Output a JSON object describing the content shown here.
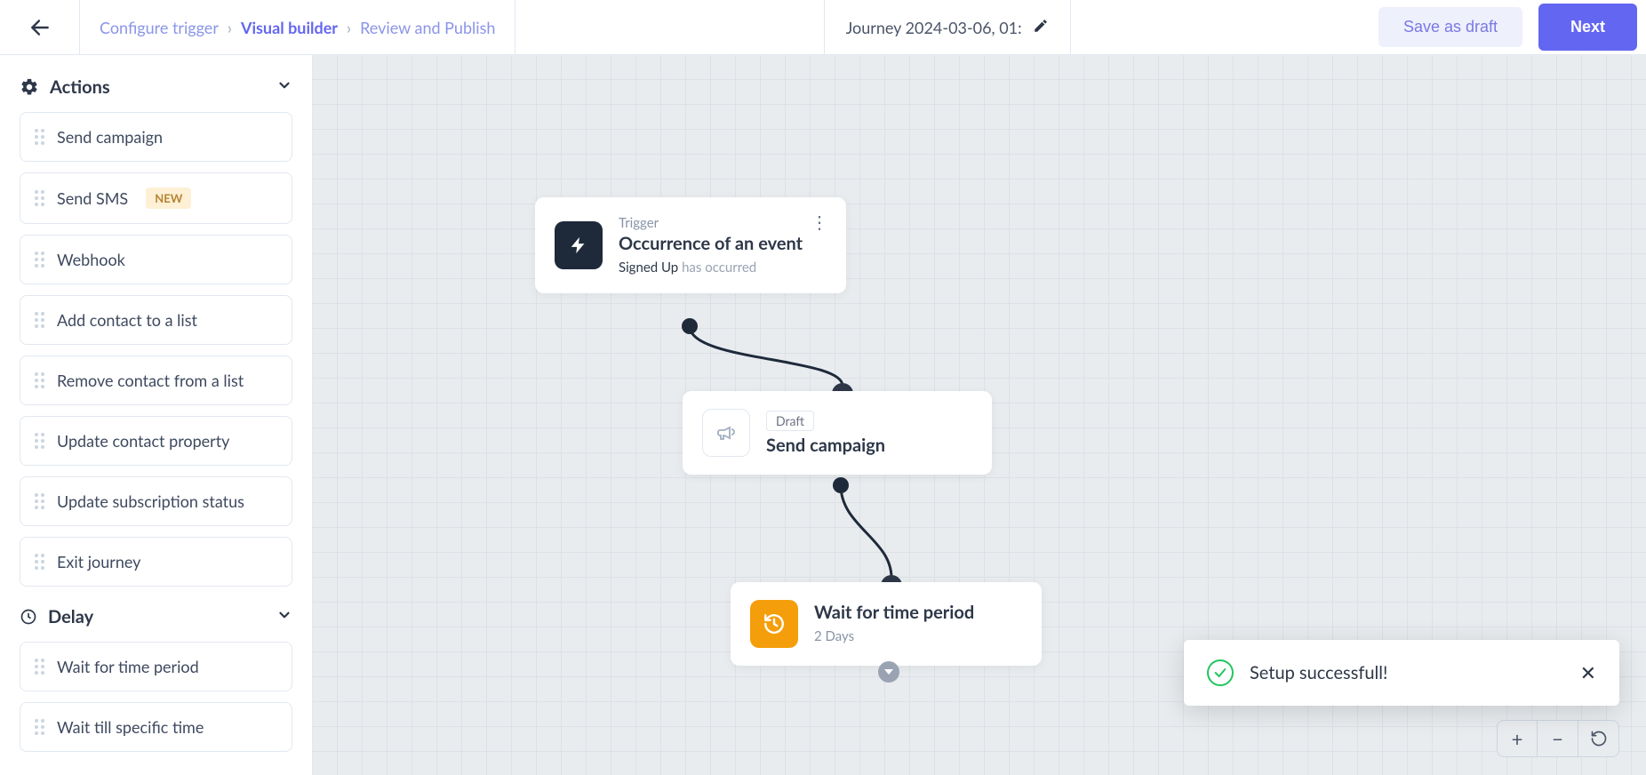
{
  "header": {
    "breadcrumbs": {
      "step1": "Configure trigger",
      "step2": "Visual builder",
      "step3": "Review and Publish"
    },
    "journey_name": "Journey 2024-03-06, 01:",
    "save_draft": "Save as draft",
    "next": "Next"
  },
  "sidebar": {
    "sections": {
      "actions": {
        "title": "Actions",
        "items": [
          {
            "label": "Send campaign",
            "badge": ""
          },
          {
            "label": "Send SMS",
            "badge": "NEW"
          },
          {
            "label": "Webhook",
            "badge": ""
          },
          {
            "label": "Add contact to a list",
            "badge": ""
          },
          {
            "label": "Remove contact from a list",
            "badge": ""
          },
          {
            "label": "Update contact property",
            "badge": ""
          },
          {
            "label": "Update subscription status",
            "badge": ""
          },
          {
            "label": "Exit journey",
            "badge": ""
          }
        ]
      },
      "delay": {
        "title": "Delay",
        "items": [
          {
            "label": "Wait for time period"
          },
          {
            "label": "Wait till specific time"
          }
        ]
      }
    }
  },
  "canvas": {
    "node1": {
      "kicker": "Trigger",
      "title": "Occurrence of an event",
      "sub_prefix": "Signed Up",
      "sub_suffix": "has occurred"
    },
    "node2": {
      "badge": "Draft",
      "title": "Send campaign"
    },
    "node3": {
      "title": "Wait for time period",
      "sub": "2 Days"
    }
  },
  "toast": {
    "message": "Setup successfull!"
  },
  "zoom": {
    "plus": "+",
    "minus": "−"
  }
}
